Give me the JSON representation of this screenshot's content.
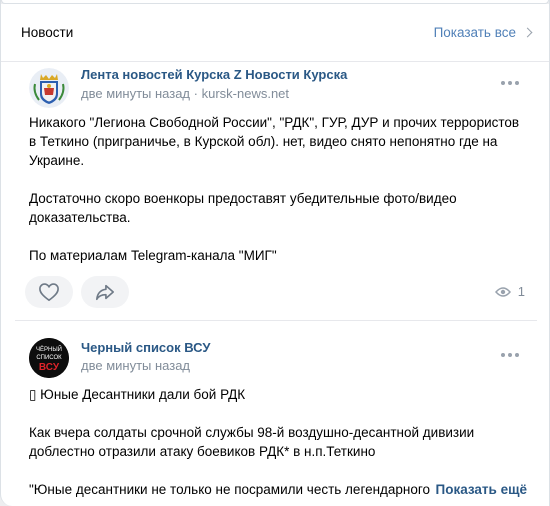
{
  "header": {
    "title": "Новости",
    "show_all": "Показать все"
  },
  "posts": [
    {
      "author": "Лента новостей Курска Z Новости Курска",
      "time": "две минуты назад",
      "source": "kursk-news.net",
      "paragraphs": [
        "Никакого \"Легиона Свободной России\", \"РДК\", ГУР, ДУР и прочих террористов в Теткино (приграничье, в Курской обл). нет, видео снято непонятно где на Украине.",
        "Достаточно скоро военкоры предоставят убедительные фото/видео доказательства.",
        "По материалам Telegram-канала \"МИГ\""
      ],
      "views": "1",
      "avatar_icon": "coat-of-arms-icon"
    },
    {
      "author": "Черный список ВСУ",
      "time": "две минуты назад",
      "avatar_text_line1": "ЧЁРНЫЙ",
      "avatar_text_line2": "СПИСОК",
      "avatar_text_line3": "ВСУ",
      "paragraphs": [
        "▯ Юные Десантники дали бой РДК",
        "Как вчера солдаты срочной службы 98-й воздушно-десантной дивизии доблестно отразили атаку боевиков РДК* в н.п.Теткино",
        "\"Юные десантники не только не посрамили честь легендарного"
      ],
      "show_more": "Показать ещё"
    }
  ],
  "colors": {
    "link": "#2a5885",
    "accent": "#5181b8",
    "meta": "#818c99",
    "button_bg": "#f2f3f5"
  }
}
